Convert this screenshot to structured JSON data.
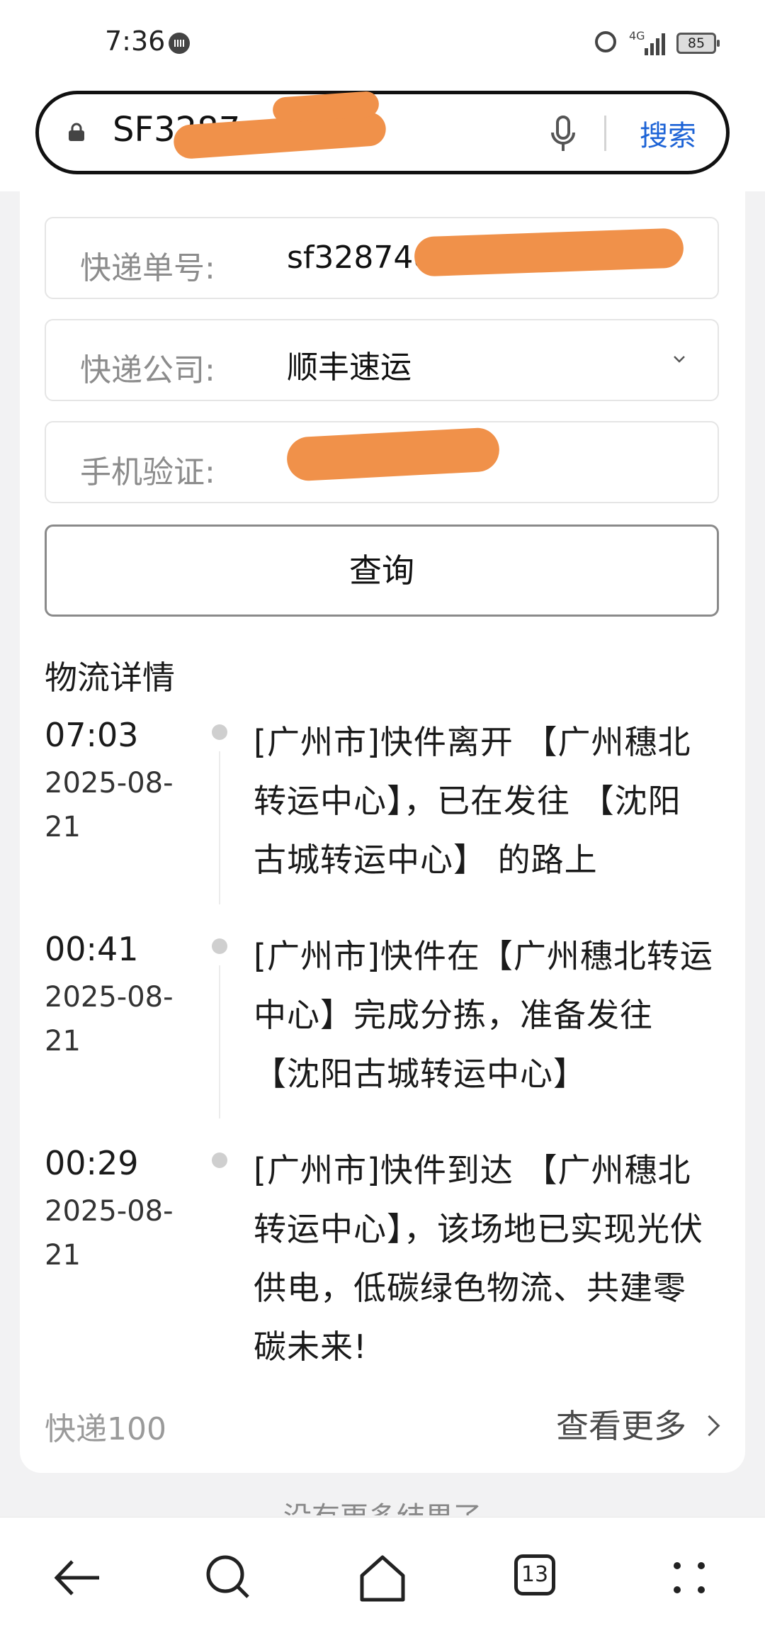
{
  "status_bar": {
    "time": "7:36",
    "network": "4G",
    "battery": "85"
  },
  "search": {
    "query": "SF3287",
    "button": "搜索"
  },
  "form": {
    "tracking_label": "快递单号:",
    "tracking_value": "sf328748",
    "company_label": "快递公司:",
    "company_value": "顺丰速运",
    "phone_label": "手机验证:",
    "phone_value": "",
    "query_button": "查询"
  },
  "logistics": {
    "title": "物流详情",
    "events": [
      {
        "time": "07:03",
        "date": "2025-08-21",
        "text": "[广州市]快件离开 【广州穗北转运中心】，已在发往 【沈阳古城转运中心】 的路上"
      },
      {
        "time": "00:41",
        "date": "2025-08-21",
        "text": "[广州市]快件在【广州穗北转运中心】完成分拣，准备发往 【沈阳古城转运中心】"
      },
      {
        "time": "00:29",
        "date": "2025-08-21",
        "text": "[广州市]快件到达 【广州穗北转运中心】，该场地已实现光伏供电，低碳绿色物流、共建零碳未来!"
      }
    ],
    "source": "快递100",
    "more": "查看更多"
  },
  "no_more_results": "没有更多结果了",
  "bottom_nav": {
    "tab_count": "13"
  },
  "colors": {
    "accent": "#1d63d6",
    "redaction": "#f0914a"
  }
}
